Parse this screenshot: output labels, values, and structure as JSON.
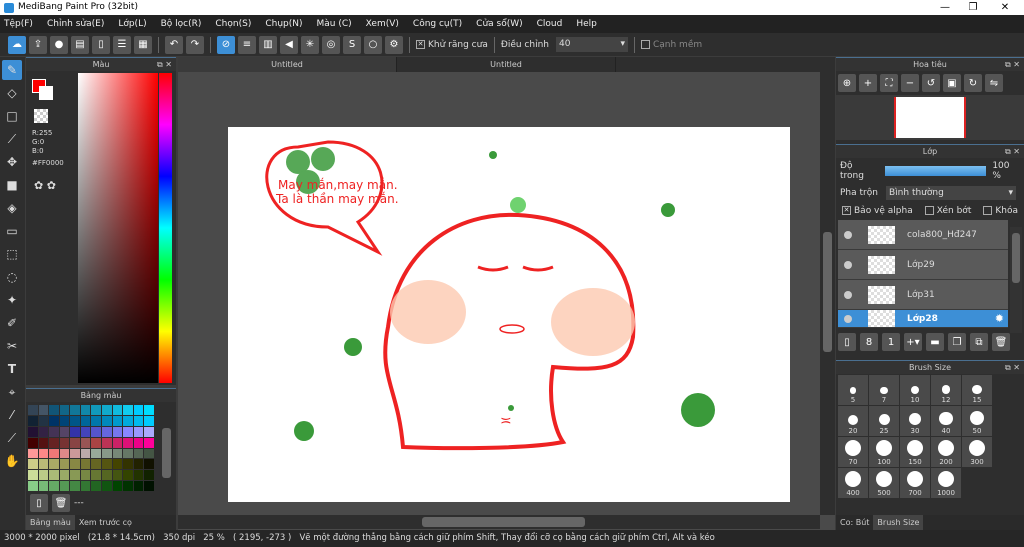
{
  "window": {
    "title": "MediBang Paint Pro (32bit)",
    "min": "—",
    "max": "❐",
    "close": "✕"
  },
  "menu": [
    "Tệp(F)",
    "Chỉnh sửa(E)",
    "Lớp(L)",
    "Bộ lọc(R)",
    "Chọn(S)",
    "Chụp(N)",
    "Màu (C)",
    "Xem(V)",
    "Công cụ(T)",
    "Cửa sổ(W)",
    "Cloud",
    "Help"
  ],
  "toolbar": {
    "antialias_label": "Khử răng cưa",
    "antialias_checked": true,
    "adjust_label": "Điều chỉnh",
    "adjust_value": "40",
    "soft_edge_label": "Cạnh mềm",
    "soft_edge_checked": false
  },
  "color_panel": {
    "title": "Màu",
    "r": "R:255",
    "g": "G:0",
    "b": "B:0",
    "hex": "#FF0000",
    "primary": "#ff0000"
  },
  "palette_panel": {
    "title": "Bảng màu",
    "name": "---"
  },
  "left_tabs": [
    "Bảng màu",
    "Xem trước cọ"
  ],
  "doc_tabs": [
    "Untitled",
    "Untitled"
  ],
  "canvas": {
    "bubble_text": [
      "May mắn,may mắn.",
      "Ta là thần may mắn."
    ]
  },
  "navigator": {
    "title": "Hoa tiêu"
  },
  "layers": {
    "title": "Lớp",
    "opacity_label": "Độ trong",
    "opacity_value": "100 %",
    "opacity": 100,
    "blend_label": "Pha trộn",
    "blend_value": "Bình thường",
    "protect_alpha": "Bảo vệ alpha",
    "clipping": "Xén bớt",
    "lock": "Khóa",
    "items": [
      {
        "name": "cola800_Hđ247",
        "selected": false
      },
      {
        "name": "Lớp29",
        "selected": false
      },
      {
        "name": "Lớp31",
        "selected": false
      },
      {
        "name": "Lớp28",
        "selected": true
      }
    ]
  },
  "brush_size": {
    "title": "Brush Size",
    "sizes": [
      "5",
      "7",
      "10",
      "12",
      "15",
      "20",
      "25",
      "30",
      "40",
      "50",
      "70",
      "100",
      "150",
      "200",
      "300",
      "400",
      "500",
      "700",
      "1000"
    ]
  },
  "right_tabs": [
    "Co: Bút",
    "Brush Size"
  ],
  "status": {
    "size": "3000 * 2000 pixel",
    "cm": "(21.8 * 14.5cm)",
    "dpi": "350 dpi",
    "zoom": "25 %",
    "coords": "( 2195, -273 )",
    "hint": "Vẽ một đường thẳng bằng cách giữ phím Shift, Thay đổi cỡ cọ bằng cách giữ phím Ctrl, Alt và kéo"
  }
}
